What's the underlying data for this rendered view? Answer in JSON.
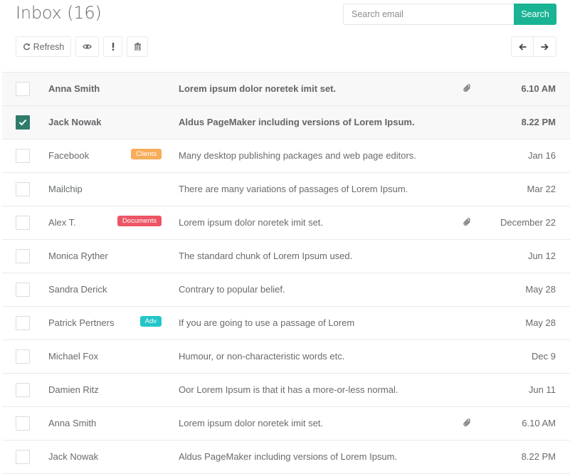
{
  "header": {
    "title": "Inbox (16)",
    "search_placeholder": "Search email",
    "search_button": "Search"
  },
  "toolbar": {
    "refresh_label": "Refresh",
    "icons": [
      "refresh-icon",
      "eye-icon",
      "exclamation-icon",
      "trash-icon",
      "arrow-left-icon",
      "arrow-right-icon"
    ]
  },
  "colors": {
    "accent": "#1ab394",
    "checked": "#2f7c6b",
    "badge_clients": "#f8ac59",
    "badge_documents": "#ed5565",
    "badge_adv": "#23c6c8"
  },
  "emails": [
    {
      "sender": "Anna Smith",
      "subject": "Lorem ipsum dolor noretek imit set.",
      "date": "6.10 AM",
      "unread": true,
      "checked": false,
      "attachment": true,
      "badge": null
    },
    {
      "sender": "Jack Nowak",
      "subject": "Aldus PageMaker including versions of Lorem Ipsum.",
      "date": "8.22 PM",
      "unread": true,
      "checked": true,
      "attachment": false,
      "badge": null
    },
    {
      "sender": "Facebook",
      "subject": "Many desktop publishing packages and web page editors.",
      "date": "Jan 16",
      "unread": false,
      "checked": false,
      "attachment": false,
      "badge": {
        "label": "Clients",
        "color": "#f8ac59"
      }
    },
    {
      "sender": "Mailchip",
      "subject": "There are many variations of passages of Lorem Ipsum.",
      "date": "Mar 22",
      "unread": false,
      "checked": false,
      "attachment": false,
      "badge": null
    },
    {
      "sender": "Alex T.",
      "subject": "Lorem ipsum dolor noretek imit set.",
      "date": "December 22",
      "unread": false,
      "checked": false,
      "attachment": true,
      "badge": {
        "label": "Documents",
        "color": "#ed5565"
      }
    },
    {
      "sender": "Monica Ryther",
      "subject": "The standard chunk of Lorem Ipsum used.",
      "date": "Jun 12",
      "unread": false,
      "checked": false,
      "attachment": false,
      "badge": null
    },
    {
      "sender": "Sandra Derick",
      "subject": "Contrary to popular belief.",
      "date": "May 28",
      "unread": false,
      "checked": false,
      "attachment": false,
      "badge": null
    },
    {
      "sender": "Patrick Pertners",
      "subject": "If you are going to use a passage of Lorem",
      "date": "May 28",
      "unread": false,
      "checked": false,
      "attachment": false,
      "badge": {
        "label": "Adv",
        "color": "#23c6c8"
      }
    },
    {
      "sender": "Michael Fox",
      "subject": "Humour, or non-characteristic words etc.",
      "date": "Dec 9",
      "unread": false,
      "checked": false,
      "attachment": false,
      "badge": null
    },
    {
      "sender": "Damien Ritz",
      "subject": "Oor Lorem Ipsum is that it has a more-or-less normal.",
      "date": "Jun 11",
      "unread": false,
      "checked": false,
      "attachment": false,
      "badge": null
    },
    {
      "sender": "Anna Smith",
      "subject": "Lorem ipsum dolor noretek imit set.",
      "date": "6.10 AM",
      "unread": false,
      "checked": false,
      "attachment": true,
      "badge": null
    },
    {
      "sender": "Jack Nowak",
      "subject": "Aldus PageMaker including versions of Lorem Ipsum.",
      "date": "8.22 PM",
      "unread": false,
      "checked": false,
      "attachment": false,
      "badge": null
    }
  ]
}
